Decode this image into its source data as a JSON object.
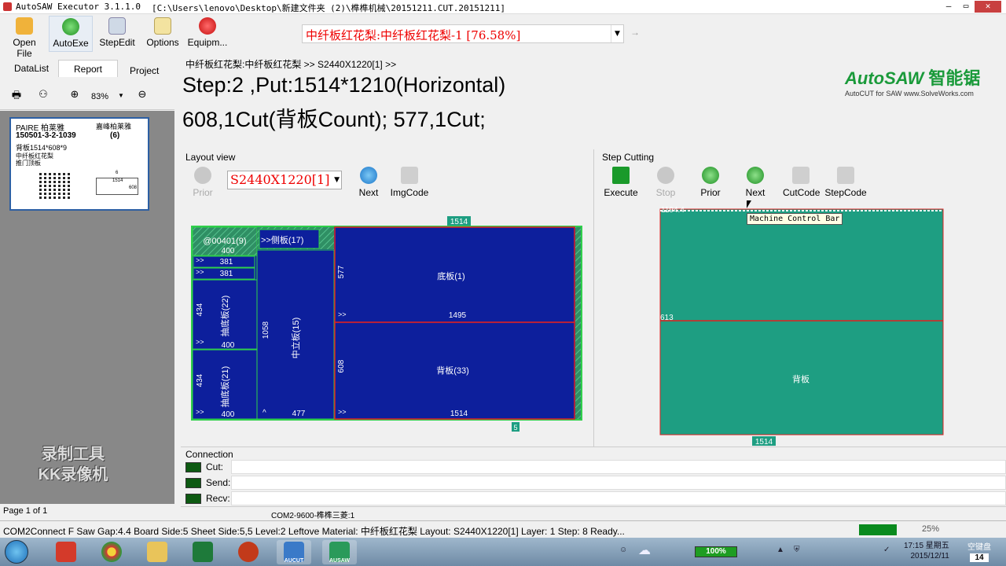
{
  "window": {
    "app_title": "AutoSAW Executor 3.1.1.0",
    "file_path": "[C:\\Users\\lenovo\\Desktop\\新建文件夹 (2)\\榫榫机械\\20151211.CUT.20151211]",
    "min": "–",
    "max": "▭",
    "close": "✕"
  },
  "toolbar": {
    "open_file": "Open File",
    "autoexe": "AutoExe",
    "stepedit": "StepEdit",
    "options": "Options",
    "equipment": "Equipm...",
    "material_select": "中纤板红花梨:中纤板红花梨-1 [76.58%]",
    "arrow": "→"
  },
  "left": {
    "tabs": [
      "DataList",
      "Report",
      "Project"
    ],
    "zoom": "83%",
    "label": {
      "line1a": "PAIRE 柏莱雅",
      "line1b": "嘉峰柏莱雅",
      "order": "150501-3-2-1039",
      "qty": "(6)",
      "part": "背板1514*608*9",
      "mat": "中纤板红花梨",
      "door": "推门顶板",
      "dim_w": "1514",
      "dim_h": "608",
      "dim_t": "6"
    },
    "watermark1": "录制工具",
    "watermark2": "KK录像机",
    "page": "Page 1 of 1"
  },
  "header": {
    "breadcrumb": "中纤板红花梨:中纤板红花梨 >> S2440X1220[1] >>",
    "step_line1": "Step:2 ,Put:1514*1210(Horizontal)",
    "step_line2": "608,1Cut(背板Count); 577,1Cut;",
    "logo_main": "AutoSAW",
    "logo_cn": "智能锯",
    "logo_sub": "AutoCUT for SAW www.SolveWorks.com"
  },
  "layout_view": {
    "title": "Layout view",
    "prior": "Prior",
    "sheet": "S2440X1220[1]",
    "next": "Next",
    "imgcode": "ImgCode",
    "top_dim": "1514",
    "bottom_tag": "5",
    "pieces": {
      "p1": "@00401(9)",
      "p1v": "400",
      "r381a": "381",
      "r381b": "381",
      "side": ">>侧板(17)",
      "chou1": "抽底板(22)",
      "chou1n": "434",
      "chou1v": "400",
      "chou2": "抽底板(21)",
      "chou2n": "434",
      "chou2v": "400",
      "mid": "中立板(15)",
      "midn": "1058",
      "midv": "477",
      "bottom": "底板(1)",
      "bottomn": "577",
      "bottomv": "1495",
      "back": "背板(33)",
      "backn": "608",
      "backv": "1514",
      "arrow": ">>",
      "caret": "^"
    }
  },
  "step_cutting": {
    "title": "Step Cutting",
    "execute": "Execute",
    "stop": "Stop",
    "prior": "Prior",
    "next": "Next",
    "cutcode": "CutCode",
    "stepcode": "StepCode",
    "top_value": "1194.4",
    "mid_value": "613",
    "piece_name": "背板",
    "bottom_dim": "1514",
    "tooltip": "Machine Control Bar"
  },
  "connection": {
    "title": "Connection",
    "cut": "Cut:",
    "send": "Send:",
    "recv": "Recv:"
  },
  "status": {
    "port": "COM2-9600-榫榫三菱:1",
    "main": "COM2Connect F  Saw Gap:4.4 Board Side:5 Sheet Side:5,5 Level:2 Leftove Material: 中纤板红花梨 Layout: S2440X1220[1] Layer: 1 Step: 8 Ready...",
    "progress": 0.25,
    "progress_label": "25%"
  },
  "taskbar": {
    "app_autocut": "AUCUT",
    "app_autosaw": "AUSAW",
    "battery": "100%",
    "time": "17:15 星期五",
    "date": "2015/12/11",
    "lang": "空键盘",
    "day": "14"
  },
  "colors": {
    "board": "#0d1f9c",
    "board_border": "#2fd04a",
    "cut_line": "#e02020",
    "cut_panel": "#1e9e82",
    "hatch": "#2f8f64"
  }
}
